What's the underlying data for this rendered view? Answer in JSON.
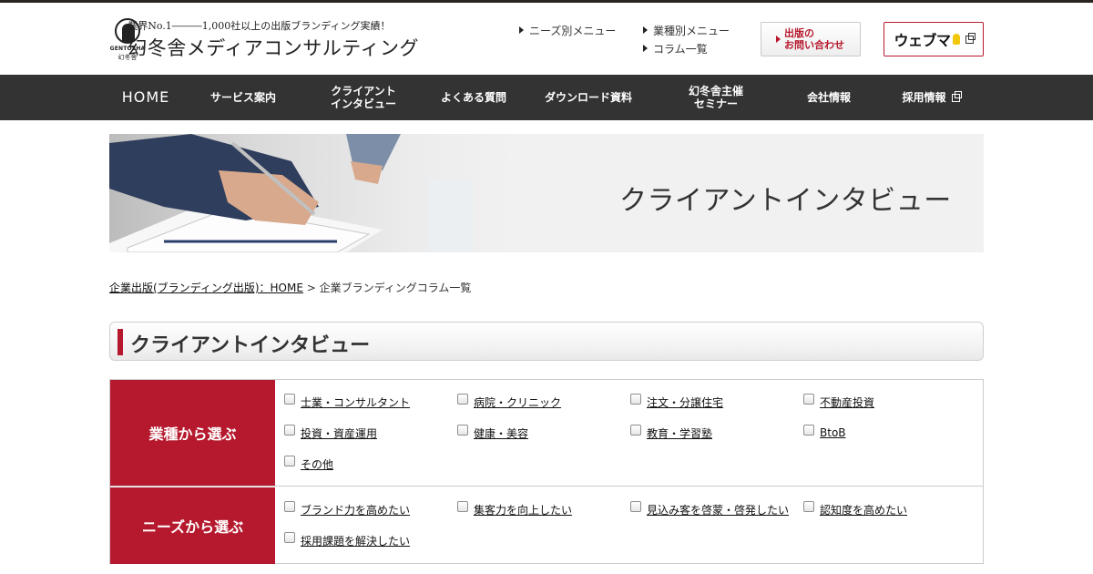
{
  "header": {
    "logo_brand": "GENTOSHA",
    "logo_brand_jp": "幻冬舎",
    "tagline": "業界No.1―――1,000社以上の出版ブランディング実績！",
    "site_name": "幻冬舎メディアコンサルティング",
    "links": [
      {
        "label": "ニーズ別メニュー"
      },
      {
        "label": "業種別メニュー"
      },
      {
        "label": "コラム一覧"
      }
    ],
    "contact_label": "出版の\nお問い合わせ",
    "webuma_label": "ウェブマ"
  },
  "nav": {
    "items": [
      {
        "label": "HOME"
      },
      {
        "label": "サービス案内"
      },
      {
        "label": "クライアント\nインタビュー"
      },
      {
        "label": "よくある質問"
      },
      {
        "label": "ダウンロード資料"
      },
      {
        "label": "幻冬舎主催\nセミナー"
      },
      {
        "label": "会社情報"
      },
      {
        "label": "採用情報"
      }
    ]
  },
  "banner": {
    "title": "クライアントインタビュー"
  },
  "breadcrumb": {
    "home_link": "企業出版(ブランディング出版)：HOME",
    "separator": " > ",
    "current": "企業ブランディングコラム一覧"
  },
  "section": {
    "heading": "クライアントインタビュー"
  },
  "filters": {
    "industry": {
      "title": "業種から選ぶ",
      "options": [
        "士業・コンサルタント",
        "病院・クリニック",
        "注文・分譲住宅",
        "不動産投資",
        "投資・資産運用",
        "健康・美容",
        "教育・学習塾",
        "BtoB",
        "その他"
      ]
    },
    "needs": {
      "title": "ニーズから選ぶ",
      "options": [
        "ブランド力を高めたい",
        "集客力を向上したい",
        "見込み客を啓蒙・啓発したい",
        "認知度を高めたい",
        "採用課題を解決したい"
      ]
    }
  },
  "colors": {
    "accent": "#b6192e",
    "nav_bg": "#333333"
  }
}
